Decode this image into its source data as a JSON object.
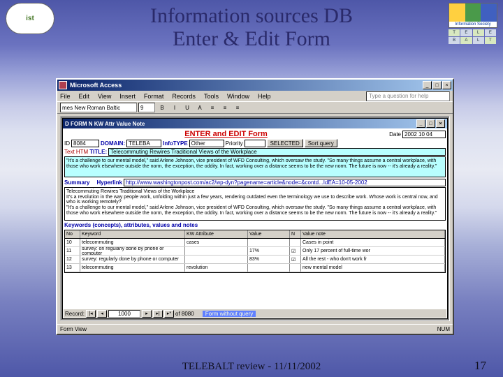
{
  "slide": {
    "title": "Information sources DB\nEnter & Edit Form",
    "footer": "TELEBALT review -  11/11/2002",
    "number": "17"
  },
  "logos": {
    "left": "ist",
    "right_label": "Information Society",
    "telebalt": [
      "T",
      "E",
      "L",
      "E",
      "B",
      "A",
      "L",
      "T"
    ]
  },
  "access": {
    "app_title": "Microsoft Access",
    "menus": [
      "File",
      "Edit",
      "View",
      "Insert",
      "Format",
      "Records",
      "Tools",
      "Window",
      "Help"
    ],
    "ask_placeholder": "Type a question for help",
    "font_name": "mes New Roman Baltic",
    "font_size": "9",
    "toolbar_glyphs": [
      "B",
      "I",
      "U",
      "A",
      "≡",
      "≡",
      "≡"
    ],
    "form_window_title": "D FORM N KW Attr Value Note",
    "form_header": "ENTER and EDIT Form",
    "labels": {
      "id": "ID",
      "domain": "DOMAIN:",
      "infotype": "InfoTYPE",
      "priority": "Priority",
      "selected": "SELECTED",
      "sort": "Sort query",
      "title": "TITLE:",
      "date": "Date",
      "summary": "Summary",
      "hyperlink": "Hyperlink",
      "keywords": "Keywords (concepts), attributes, values and notes",
      "text": "Text HTM"
    },
    "values": {
      "id": "8084",
      "domain": "TELEBA",
      "infotype": "Other",
      "priority": "",
      "date": "2002 10 04",
      "title": "Telecommuting Rewires Traditional Views of the Workplace",
      "hyperlink": "http://www.washingtonpost.com/ac2/wp-dyn?pagename=article&node=&contd...IdEA=10-05-2002",
      "first_block": "\"It's a challenge to our mental model,\" said Arlene Johnson, vice president of WFD Consulting, which oversaw the study. \"So many things assume a central workplace, with those who work elsewhere outside the norm, the exception, the oddity. In fact, working over a distance seems to be the new norm. The future is now -- it's already a reality.\"",
      "summary_block": "Telecommuting Rewires Traditional Views of the Workplace\nIt's a revolution in the way people work, unfolding within just a few years, rendering outdated even the terminology we use to describe work. Whose work is central now, and who is working remotely?\n\"It's a challenge to our mental model,\" said Arlene Johnson, vice president of WFD Consulting, which oversaw the study. \"So many things assume a central workplace, with those who work elsewhere outside the norm, the exception, the oddity. In fact, working over a distance seems to be the new norm. The future is now -- it's already a reality.\""
    },
    "table": {
      "headers": [
        "No",
        "Keyword",
        "KW Attribute",
        "Value",
        "N",
        "Value note"
      ],
      "rows": [
        [
          "10",
          "telecommuting",
          "cases",
          "",
          "",
          "Cases in point"
        ],
        [
          "11",
          "survey: on regularly done by phone or computer",
          "",
          "17%",
          "☑",
          "Only 17 percent of full-time wor"
        ],
        [
          "12",
          "survey: regularly done by phone or computer",
          "",
          "83%",
          "☑",
          "All the rest - who don't work fr"
        ],
        [
          "13",
          "telecommuting",
          "revolution",
          "",
          "",
          "new mental model"
        ]
      ]
    },
    "record_nav": {
      "label": "Record:",
      "current": "1000",
      "total": "of  8080",
      "query_note": "Form without query"
    },
    "status_left": "Form View",
    "status_right": "NUM"
  }
}
